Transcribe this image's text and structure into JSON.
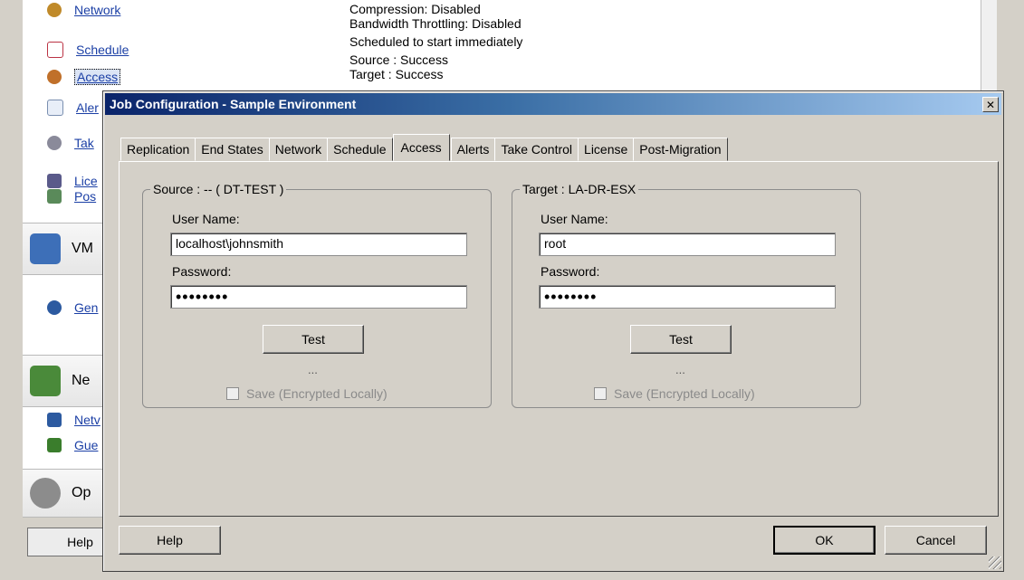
{
  "background": {
    "sidebar_items": [
      {
        "label": "Network",
        "icon": "network-icon",
        "color": "#c08a2a"
      },
      {
        "label": "Schedule",
        "icon": "calendar-icon",
        "color": "#b34"
      },
      {
        "label": "Access",
        "icon": "users-icon",
        "color": "#3a7d2c",
        "selected": true
      },
      {
        "label": "Aler",
        "icon": "envelope-icon",
        "color": "#7a8fb0"
      },
      {
        "label": "Tak",
        "icon": "hand-icon",
        "color": "#8a8a9a"
      },
      {
        "label": "Lice",
        "icon": "license-icon",
        "color": "#5a5a8a"
      },
      {
        "label": "Pos",
        "icon": "post-icon",
        "color": "#5a8a5a"
      },
      {
        "label": "Gen",
        "icon": "people-icon",
        "color": "#2c5aa0"
      },
      {
        "label": "Netv",
        "icon": "nic-icon",
        "color": "#2c5aa0"
      },
      {
        "label": "Gue",
        "icon": "guest-icon",
        "color": "#3a7d2c"
      }
    ],
    "sections": [
      {
        "label": "VM",
        "icon": "vm-cubes-icon"
      },
      {
        "label": "Ne",
        "icon": "network-card-icon"
      },
      {
        "label": "Op",
        "icon": "options-gear-icon"
      }
    ],
    "details": {
      "line1": "Compression: Disabled",
      "line2": "Bandwidth Throttling: Disabled",
      "line3": "Scheduled to start immediately",
      "line4": "Source : Success",
      "line5": "Target : Success"
    },
    "help_button": "Help"
  },
  "dialog": {
    "title": "Job Configuration - Sample Environment",
    "close_glyph": "✕",
    "tabs": [
      "Replication",
      "End States",
      "Network",
      "Schedule",
      "Access",
      "Alerts",
      "Take Control",
      "License",
      "Post-Migration"
    ],
    "active_tab": "Access",
    "source": {
      "legend": "Source : -- ( DT-TEST )",
      "username_label": "User Name:",
      "username_value": "localhost\\johnsmith",
      "password_label": "Password:",
      "password_value": "••••••••",
      "test_button": "Test",
      "status": "...",
      "save_label": "Save (Encrypted Locally)"
    },
    "target": {
      "legend": "Target : LA-DR-ESX",
      "username_label": "User Name:",
      "username_value": "root",
      "password_label": "Password:",
      "password_value": "••••••••",
      "test_button": "Test",
      "status": "...",
      "save_label": "Save (Encrypted Locally)"
    },
    "buttons": {
      "help": "Help",
      "ok": "OK",
      "cancel": "Cancel"
    }
  },
  "colors": {
    "title_start": "#0a246a",
    "title_end": "#a6caf0",
    "face": "#d4d0c8",
    "link": "#1b3fa5"
  }
}
